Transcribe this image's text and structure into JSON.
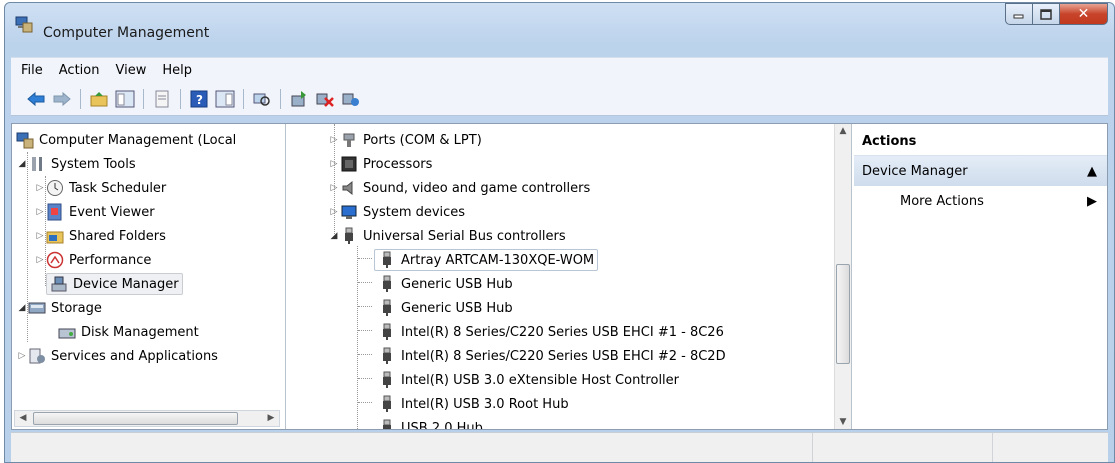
{
  "window": {
    "title": "Computer Management"
  },
  "menu": [
    "File",
    "Action",
    "View",
    "Help"
  ],
  "left_tree": {
    "root": "Computer Management (Local",
    "system_tools": "System Tools",
    "task_scheduler": "Task Scheduler",
    "event_viewer": "Event Viewer",
    "shared_folders": "Shared Folders",
    "performance": "Performance",
    "device_manager": "Device Manager",
    "storage": "Storage",
    "disk_management": "Disk Management",
    "services_apps": "Services and Applications"
  },
  "device_tree": {
    "ports": "Ports (COM & LPT)",
    "processors": "Processors",
    "sound": "Sound, video and game controllers",
    "system_devices": "System devices",
    "usb_controllers": "Universal Serial Bus controllers",
    "usb_items": [
      "Artray ARTCAM-130XQE-WOM",
      "Generic USB Hub",
      "Generic USB Hub",
      "Intel(R) 8 Series/C220 Series USB EHCI #1 - 8C26",
      "Intel(R) 8 Series/C220 Series USB EHCI #2 - 8C2D",
      "Intel(R) USB 3.0 eXtensible Host Controller",
      "Intel(R) USB 3.0 Root Hub",
      "USB 2.0 Hub"
    ]
  },
  "actions": {
    "header": "Actions",
    "section": "Device Manager",
    "more": "More Actions"
  },
  "colors": {
    "accent": "#cfdcec",
    "title_bg": "#bcd3ec",
    "close": "#c7442a"
  }
}
